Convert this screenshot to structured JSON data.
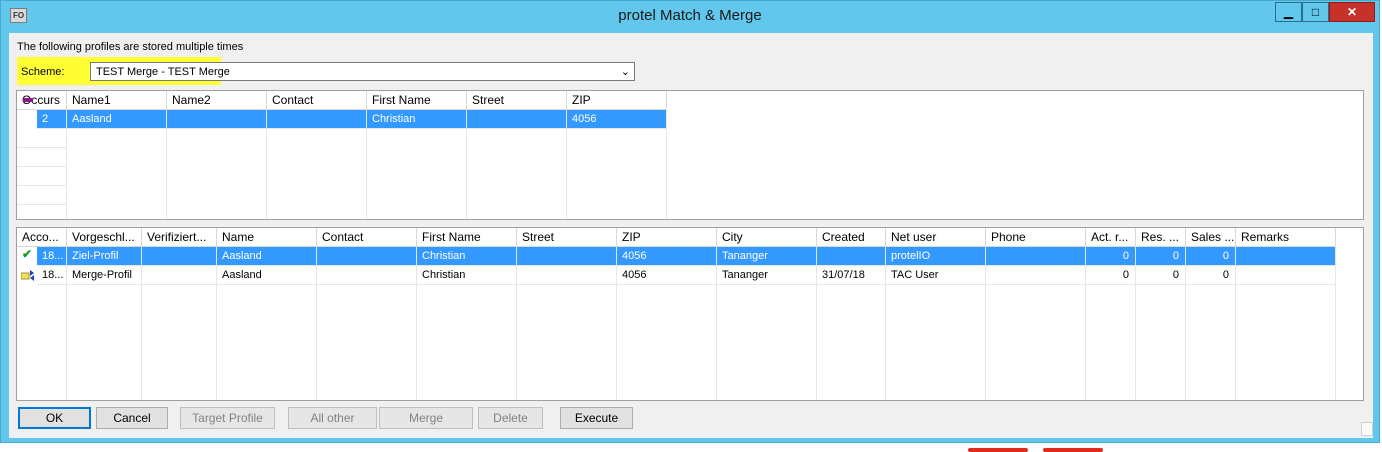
{
  "window": {
    "title": "protel Match & Merge",
    "app_icon_label": "FO",
    "minimize_glyph": "▁",
    "maximize_glyph": "□",
    "close_glyph": "✕"
  },
  "intro_text": "The following profiles are stored multiple times",
  "scheme": {
    "label": "Scheme:",
    "value": "TEST Merge  - TEST Merge",
    "highlight_color": "#ffff33"
  },
  "top_grid": {
    "columns": [
      "Occurs",
      "Name1",
      "Name2",
      "Contact",
      "First Name",
      "Street",
      "ZIP"
    ],
    "rows": [
      {
        "occurs": "2",
        "name1": "Aasland",
        "name2": "",
        "contact": "",
        "first_name": "Christian",
        "street": "",
        "zip": "4056",
        "selected": true
      }
    ]
  },
  "bottom_grid": {
    "columns": [
      "Acco...",
      "Vorgeschl...",
      "Verifiziert...",
      "Name",
      "Contact",
      "First Name",
      "Street",
      "ZIP",
      "City",
      "Created",
      "Net user",
      "Phone",
      "Act. r...",
      "Res. ...",
      "Sales ...",
      "Remarks"
    ],
    "rows": [
      {
        "icon": "check-icon",
        "account": "18...",
        "vorgeschlagen": "Ziel-Profil",
        "verifiziert": "",
        "name": "Aasland",
        "contact": "",
        "first_name": "Christian",
        "street": "",
        "zip": "4056",
        "city": "Tananger",
        "created": "",
        "net_user": "protelIO",
        "phone": "",
        "act": "0",
        "res": "0",
        "sales": "0",
        "remarks": "",
        "selected": true
      },
      {
        "icon": "merge-icon",
        "account": "18...",
        "vorgeschlagen": "Merge-Profil",
        "verifiziert": "",
        "name": "Aasland",
        "contact": "",
        "first_name": "Christian",
        "street": "",
        "zip": "4056",
        "city": "Tananger",
        "created": "31/07/18",
        "net_user": "TAC User",
        "phone": "",
        "act": "0",
        "res": "0",
        "sales": "0",
        "remarks": "",
        "selected": false
      }
    ]
  },
  "buttons": {
    "ok": "OK",
    "cancel": "Cancel",
    "target_profile": "Target Profile",
    "all_other": "All other",
    "merge": "Merge",
    "delete": "Delete",
    "execute": "Execute"
  },
  "colors": {
    "title_bar": "#62c7ec",
    "selection": "#3399ff",
    "close_button": "#c7312a"
  }
}
